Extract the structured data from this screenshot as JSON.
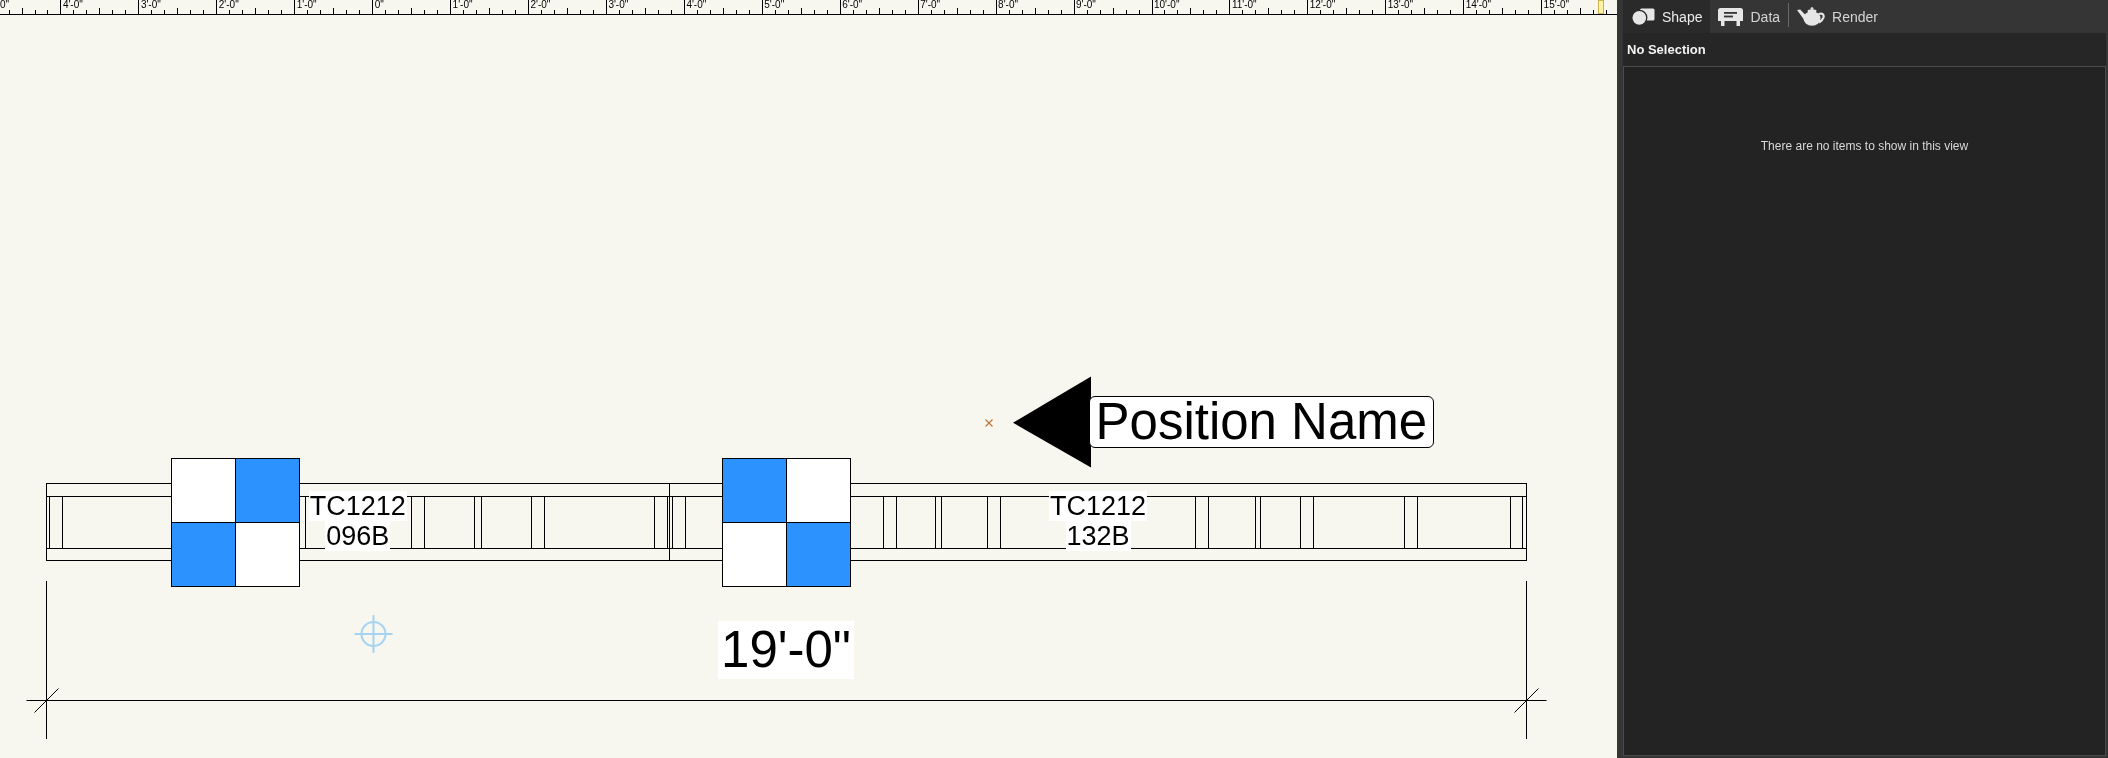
{
  "ruler": {
    "labels": [
      "0\"",
      "4'-0\"",
      "3'-0\"",
      "2'-0\"",
      "1'-0\"",
      "0\"",
      "1'-0\"",
      "2'-0\"",
      "3'-0\"",
      "4'-0\"",
      "5'-0\"",
      "6'-0\"",
      "7'-0\"",
      "8'-0\"",
      "9'-0\"",
      "10'-0\"",
      "11'-0\"",
      "12'-0\"",
      "13'-0\"",
      "14'-0\"",
      "15'-0\""
    ]
  },
  "drawing": {
    "position_label": {
      "text": "Position Name"
    },
    "blocks": [
      {
        "cells": [
          {
            "filled": false
          },
          {
            "filled": true
          },
          {
            "filled": true
          },
          {
            "filled": false
          }
        ]
      },
      {
        "cells": [
          {
            "filled": true
          },
          {
            "filled": false
          },
          {
            "filled": false
          },
          {
            "filled": true
          }
        ]
      }
    ],
    "truss_sections": [
      {
        "label_lines": [
          "TC1212",
          "096B"
        ]
      },
      {
        "label_lines": [
          "TC1212",
          "132B"
        ]
      }
    ],
    "dimension": {
      "text": "19'-0\""
    }
  },
  "panel": {
    "tabs": [
      {
        "label": "Shape",
        "selected": true
      },
      {
        "label": "Data",
        "selected": false
      },
      {
        "label": "Render",
        "selected": false
      }
    ],
    "heading": "No Selection",
    "empty_message": "There are no items to show in this view"
  }
}
